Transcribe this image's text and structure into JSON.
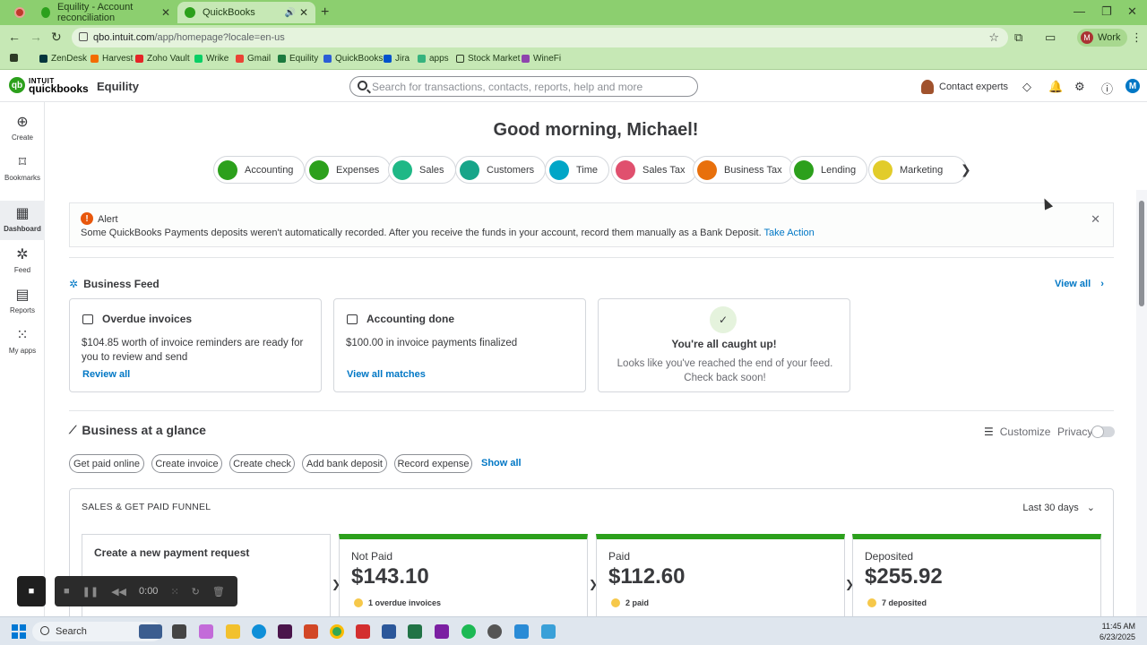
{
  "browser": {
    "tabs": [
      {
        "title": "Equility - Account reconciliation"
      },
      {
        "title": "QuickBooks"
      }
    ],
    "url_host": "qbo.intuit.com",
    "url_path": "/app/homepage?locale=en-us",
    "profile_label": "Work",
    "profile_initial": "M",
    "bookmarks": [
      "ZenDesk",
      "Harvest",
      "Zoho Vault",
      "Wrike",
      "Gmail",
      "Equility",
      "QuickBooks",
      "Jira",
      "apps",
      "Stock Market",
      "WineFi"
    ]
  },
  "qb_header": {
    "logo_top": "INTUIT",
    "logo_bottom": "quickbooks",
    "company": "Equility",
    "search_placeholder": "Search for transactions, contacts, reports, help and more",
    "contact_experts": "Contact experts",
    "avatar_initial": "M"
  },
  "leftnav": [
    {
      "label": "Create"
    },
    {
      "label": "Bookmarks"
    },
    {
      "label": "Dashboard"
    },
    {
      "label": "Feed"
    },
    {
      "label": "Reports"
    },
    {
      "label": "My apps"
    }
  ],
  "greeting": "Good morning, Michael!",
  "pills": [
    "Accounting",
    "Expenses",
    "Sales",
    "Customers",
    "Time",
    "Sales Tax",
    "Business Tax",
    "Lending",
    "Marketing"
  ],
  "alert": {
    "title": "Alert",
    "message": "Some QuickBooks Payments deposits weren't automatically recorded. After you receive the funds in your account, record them manually as a Bank Deposit.",
    "link": "Take Action"
  },
  "business_feed": {
    "title": "Business Feed",
    "view_all": "View all",
    "cards": [
      {
        "title": "Overdue invoices",
        "body": "$104.85 worth of invoice reminders are ready for you to review and send",
        "link": "Review all"
      },
      {
        "title": "Accounting done",
        "body": "$100.00 in invoice payments finalized",
        "link": "View all matches"
      },
      {
        "title": "You're all caught up!",
        "body": "Looks like you've reached the end of your feed. Check back soon!"
      }
    ]
  },
  "glance": {
    "title": "Business at a glance",
    "customize": "Customize",
    "privacy": "Privacy",
    "actions": [
      "Get paid online",
      "Create invoice",
      "Create check",
      "Add bank deposit",
      "Record expense"
    ],
    "show_all": "Show all"
  },
  "funnel": {
    "title": "SALES & GET PAID FUNNEL",
    "range": "Last 30 days",
    "first_label": "Create a new payment request",
    "columns": [
      {
        "label": "Not Paid",
        "amount": "$143.10",
        "sub": "1 overdue invoices"
      },
      {
        "label": "Paid",
        "amount": "$112.60",
        "sub": "2 paid"
      },
      {
        "label": "Deposited",
        "amount": "$255.92",
        "sub": "7 deposited"
      }
    ]
  },
  "recorder": {
    "time": "0:00"
  },
  "taskbar": {
    "search": "Search",
    "time": "11:45 AM",
    "date": "6/23/2025"
  },
  "colors": {
    "brand_green": "#2ca01c",
    "link_blue": "#0077c5",
    "alert_orange": "#e8570c"
  }
}
